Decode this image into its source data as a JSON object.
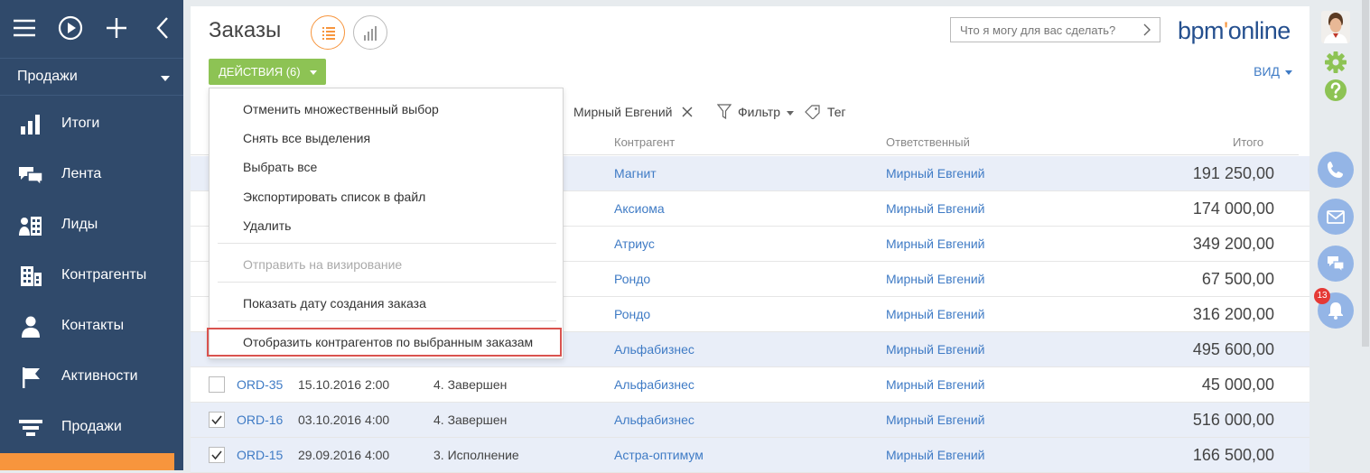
{
  "app": {
    "section": "Продажи"
  },
  "nav": [
    {
      "label": "Итоги",
      "icon": "bar-chart-icon"
    },
    {
      "label": "Лента",
      "icon": "feed-icon"
    },
    {
      "label": "Лиды",
      "icon": "leads-icon"
    },
    {
      "label": "Контрагенты",
      "icon": "building-icon"
    },
    {
      "label": "Контакты",
      "icon": "person-icon"
    },
    {
      "label": "Активности",
      "icon": "flag-icon"
    },
    {
      "label": "Продажи",
      "icon": "funnel-icon"
    }
  ],
  "header": {
    "title": "Заказы",
    "search_placeholder": "Что я могу для вас сделать?",
    "logo_main": "bpm",
    "logo_dot": "'",
    "logo_tail": "online"
  },
  "toolbar": {
    "actions_label": "ДЕЙСТВИЯ (6)",
    "view_label": "ВИД"
  },
  "filters": {
    "owner": "Мирный Евгений",
    "filter_label": "Фильтр",
    "tag_label": "Тег"
  },
  "columns": {
    "account": "Контрагент",
    "owner": "Ответственный",
    "total": "Итого"
  },
  "rows": [
    {
      "number": "",
      "date": "",
      "state": "",
      "account": "Магнит",
      "owner": "Мирный Евгений",
      "total": "191 250,00",
      "selected": true
    },
    {
      "number": "",
      "date": "",
      "state": "",
      "account": "Аксиома",
      "owner": "Мирный Евгений",
      "total": "174 000,00",
      "selected": false
    },
    {
      "number": "",
      "date": "",
      "state": "",
      "account": "Атриус",
      "owner": "Мирный Евгений",
      "total": "349 200,00",
      "selected": false
    },
    {
      "number": "",
      "date": "",
      "state": "",
      "account": "Рондо",
      "owner": "Мирный Евгений",
      "total": "67 500,00",
      "selected": false
    },
    {
      "number": "",
      "date": "",
      "state": "",
      "account": "Рондо",
      "owner": "Мирный Евгений",
      "total": "316 200,00",
      "selected": false
    },
    {
      "number": "",
      "date": "",
      "state": "",
      "account": "Альфабизнес",
      "owner": "Мирный Евгений",
      "total": "495 600,00",
      "selected": true
    },
    {
      "number": "ORD-35",
      "date": "15.10.2016 2:00",
      "state": "4. Завершен",
      "account": "Альфабизнес",
      "owner": "Мирный Евгений",
      "total": "45 000,00",
      "selected": false
    },
    {
      "number": "ORD-16",
      "date": "03.10.2016 4:00",
      "state": "4. Завершен",
      "account": "Альфабизнес",
      "owner": "Мирный Евгений",
      "total": "516 000,00",
      "selected": true
    },
    {
      "number": "ORD-15",
      "date": "29.09.2016 4:00",
      "state": "3. Исполнение",
      "account": "Астра-оптимум",
      "owner": "Мирный Евгений",
      "total": "166 500,00",
      "selected": true
    }
  ],
  "menu": {
    "items": [
      "Отменить множественный выбор",
      "Снять все выделения",
      "Выбрать все",
      "Экспортировать список в файл",
      "Удалить",
      "Отправить на визирование",
      "Показать дату создания заказа",
      "Отобразить контрагентов по выбранным заказам"
    ]
  },
  "notifications": {
    "count": "13"
  },
  "colors": {
    "sidebar": "#304a6b",
    "accent": "#f7953d",
    "action": "#8dc354",
    "link": "#3f7bc5",
    "highlight": "#d9534f"
  }
}
